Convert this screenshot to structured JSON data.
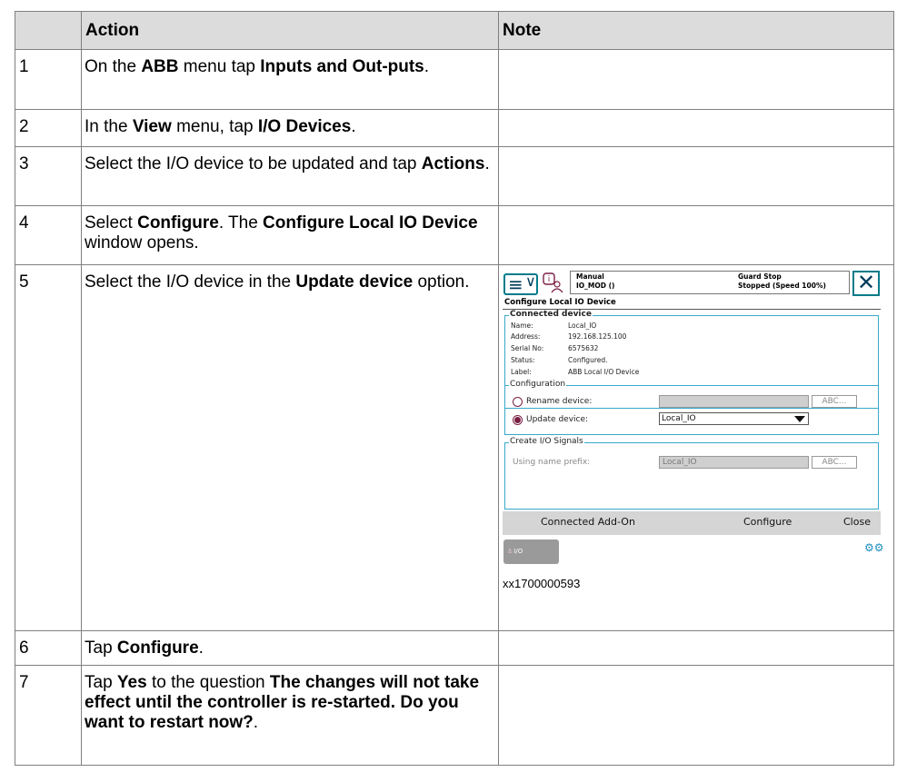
{
  "header": {
    "col1": "",
    "action": "Action",
    "note": "Note"
  },
  "steps": [
    {
      "num": "1",
      "a": "On the ",
      "b": "ABB",
      "c": " menu tap ",
      "d": "Inputs and Out-puts",
      "e": "."
    },
    {
      "num": "2",
      "a": "In the ",
      "b": "View",
      "c": " menu, tap ",
      "d": "I/O Devices",
      "e": "."
    },
    {
      "num": "3",
      "a": "Select the I/O device to be updated and tap ",
      "b": "Actions",
      "c": "."
    },
    {
      "num": "4",
      "a": "Select ",
      "b": "Configure",
      "c": ". The ",
      "d": "Configure Local IO Device",
      "e": " window opens."
    },
    {
      "num": "5",
      "a": "Select the I/O device in the ",
      "b": "Update device",
      "c": " option."
    },
    {
      "num": "6",
      "a": "Tap ",
      "b": "Configure",
      "c": "."
    },
    {
      "num": "7",
      "a": "Tap ",
      "b": "Yes",
      "c": " to the question ",
      "d": "The changes will not take effect until the controller is re-started. Do you want to restart now?",
      "e": "."
    }
  ],
  "screenshot": {
    "status_left1": "Manual",
    "status_left2": "IO_MOD ()",
    "status_right1": "Guard Stop",
    "status_right2": "Stopped (Speed 100%)",
    "window_title": "Configure Local IO Device",
    "connected": {
      "legend": "Connected device",
      "rows": [
        {
          "k": "Name:",
          "v": "Local_IO"
        },
        {
          "k": "Address:",
          "v": "192.168.125.100"
        },
        {
          "k": "Serial No:",
          "v": "6575632"
        },
        {
          "k": "Status:",
          "v": "Configured."
        },
        {
          "k": "Label:",
          "v": "ABB Local I/O Device"
        }
      ]
    },
    "configuration": {
      "legend": "Configuration",
      "rename_label": "Rename device:",
      "update_label": "Update device:",
      "update_value": "Local_IO",
      "abc": "ABC..."
    },
    "signals": {
      "legend": "Create I/O Signals",
      "prefix_label": "Using name prefix:",
      "prefix_value": "Local_IO",
      "abc": "ABC..."
    },
    "cmd": {
      "addon": "Connected Add-On",
      "configure": "Configure",
      "close": "Close"
    },
    "tab_label": "I/O",
    "icons": {
      "menu": "hamburger-icon",
      "info": "robot-info-icon",
      "close": "close-icon",
      "gears": "gears-icon"
    }
  },
  "caption": "xx1700000593"
}
